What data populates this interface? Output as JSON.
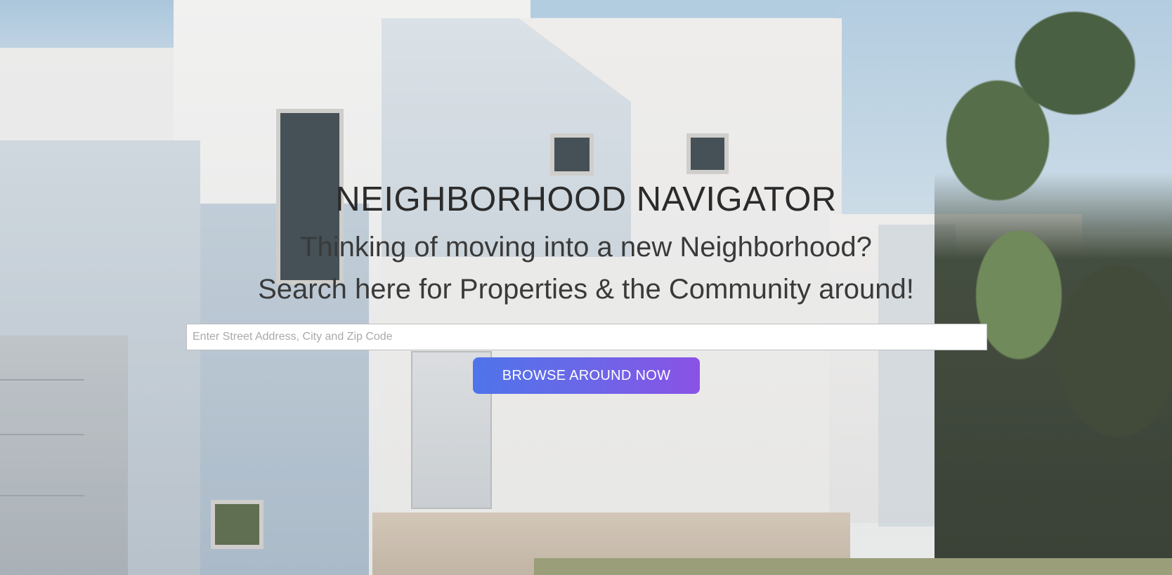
{
  "hero": {
    "background_image": "modern-white-house-photo",
    "title": "NEIGHBORHOOD NAVIGATOR",
    "subtitle_line1": "Thinking of moving into a new Neighborhood?",
    "subtitle_line2": "Search here for Properties & the Community around!"
  },
  "search": {
    "placeholder": "Enter Street Address, City and Zip Code",
    "value": ""
  },
  "cta": {
    "label": "BROWSE AROUND NOW",
    "gradient_start": "#4f74ea",
    "gradient_end": "#8a52e6"
  },
  "colors": {
    "title_text": "#2b2b2b",
    "subtitle_text": "#3a3a3a",
    "button_text": "#ffffff"
  }
}
